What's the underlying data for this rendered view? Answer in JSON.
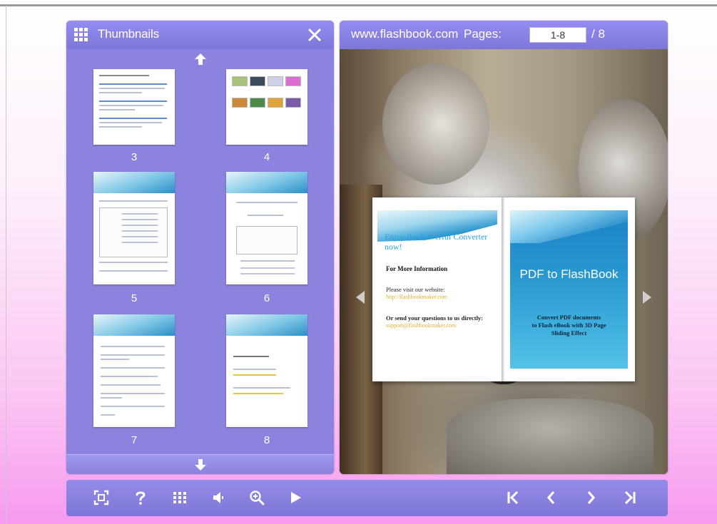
{
  "thumbnails_panel": {
    "title": "Thumbnails",
    "pages": [
      {
        "number": "3"
      },
      {
        "number": "4"
      },
      {
        "number": "5"
      },
      {
        "number": "6"
      },
      {
        "number": "7"
      },
      {
        "number": "8"
      }
    ]
  },
  "viewer": {
    "site": "www.flashbook.com",
    "pages_label": "Pages:",
    "page_value": "1-8",
    "total": "/ 8"
  },
  "left_page": {
    "title": "Enjoy the Powerful Converter now!",
    "heading": "For More Information",
    "visit_text": "Please visit our website:",
    "website_link": "http://flashbookmaker.com",
    "questions_text": "Or send your questions to us directly:",
    "email_link": "support@flashbookmaker.com"
  },
  "right_page": {
    "title": "PDF to FlashBook",
    "subtitle_line1": "Convert PDF documents",
    "subtitle_line2": "to Flash eBook with 3D Page",
    "subtitle_line3": "Sliding Effect"
  },
  "colors": {
    "panel": "#8a82dc",
    "header": "#857ee0",
    "cover_blue": "#2897cf"
  },
  "toolbar": {
    "left_icons": [
      "fit-screen-icon",
      "help-icon",
      "thumbnails-icon",
      "sound-icon",
      "zoom-in-icon",
      "autoplay-icon"
    ],
    "right_icons": [
      "first-page-icon",
      "previous-page-icon",
      "next-page-icon",
      "last-page-icon"
    ]
  }
}
